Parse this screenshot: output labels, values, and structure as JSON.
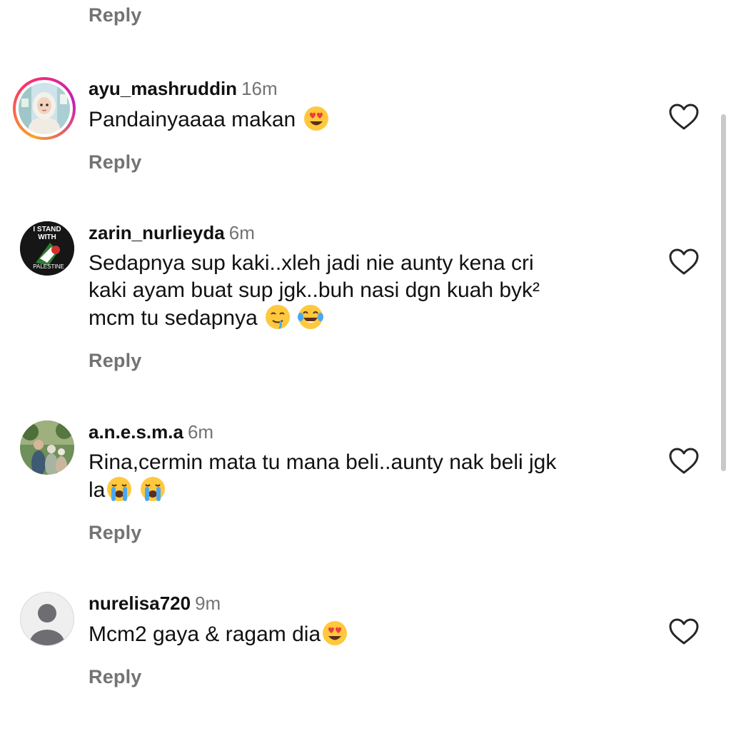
{
  "reply_label": "Reply",
  "comments": [
    {
      "username": "ayu_mashruddin",
      "time": "16m",
      "text": "Pandainyaaaa makan",
      "emojis": [
        "heart-eyes"
      ]
    },
    {
      "username": "zarin_nurlieyda",
      "time": "6m",
      "text_lines": [
        "Sedapnya sup kaki..xleh jadi nie aunty kena cri",
        "kaki ayam buat sup jgk..buh nasi dgn kuah byk²",
        "mcm tu sedapnya"
      ],
      "emojis": [
        "drooling",
        "tears-of-joy"
      ],
      "avatar_text": [
        "I STAND",
        "WITH",
        "PALESTINE"
      ]
    },
    {
      "username": "a.n.e.s.m.a",
      "time": "6m",
      "text_lines": [
        "Rina,cermin mata tu mana beli..aunty nak beli jgk",
        "la"
      ],
      "emojis": [
        "loudly-crying",
        "loudly-crying"
      ]
    },
    {
      "username": "nurelisa720",
      "time": "9m",
      "text": "Mcm2 gaya & ragam dia",
      "emojis": [
        "heart-eyes"
      ]
    }
  ],
  "colors": {
    "text": "#111111",
    "muted": "#737373",
    "heart_stroke": "#262626",
    "emoji_yellow": "#ffc83d",
    "emoji_red": "#ef3b3b",
    "tear_blue": "#4aa8f0"
  },
  "icons": [
    "heart-icon",
    "default-avatar-icon"
  ]
}
